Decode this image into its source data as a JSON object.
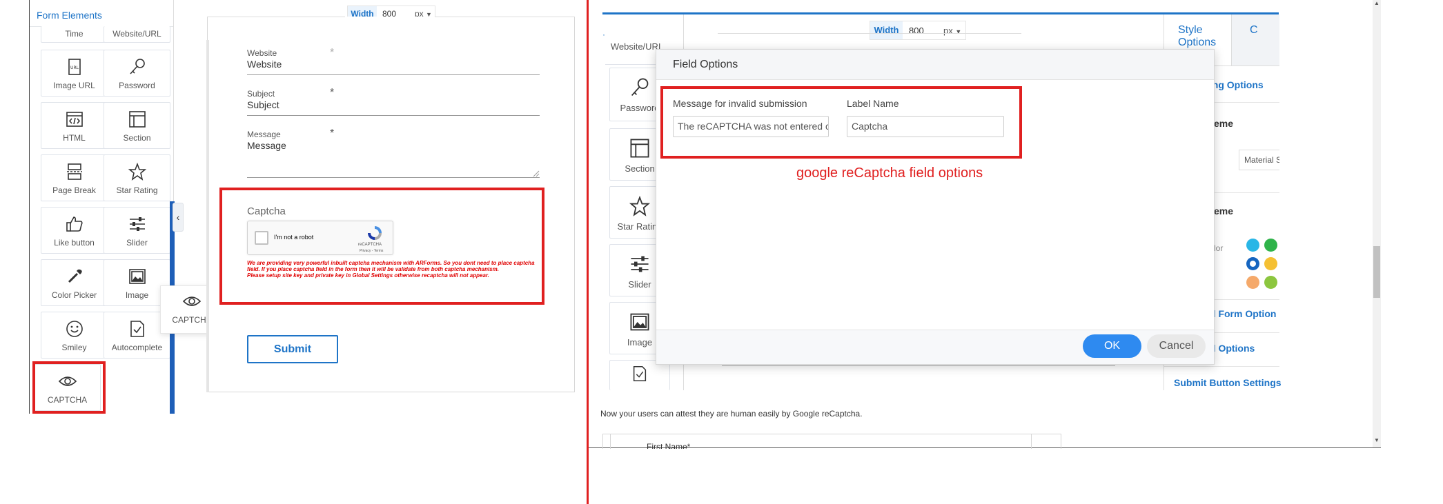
{
  "left_panel": {
    "header": "Form Elements",
    "elements": [
      {
        "label": "Time",
        "icon": "clock-icon"
      },
      {
        "label": "Website/URL",
        "icon": "globe-icon"
      },
      {
        "label": "Image URL",
        "icon": "image-url-icon"
      },
      {
        "label": "Password",
        "icon": "key-icon"
      },
      {
        "label": "HTML",
        "icon": "code-icon"
      },
      {
        "label": "Section",
        "icon": "section-icon"
      },
      {
        "label": "Page Break",
        "icon": "page-break-icon"
      },
      {
        "label": "Star Rating",
        "icon": "star-icon"
      },
      {
        "label": "Like button",
        "icon": "thumbs-up-icon"
      },
      {
        "label": "Slider",
        "icon": "slider-icon"
      },
      {
        "label": "Color Picker",
        "icon": "eyedropper-icon"
      },
      {
        "label": "Image",
        "icon": "image-icon"
      },
      {
        "label": "Smiley",
        "icon": "smiley-icon"
      },
      {
        "label": "Autocomplete",
        "icon": "autocomplete-icon"
      },
      {
        "label": "CAPTCHA",
        "icon": "eye-icon"
      }
    ],
    "drag_ghost_label": "CAPTCHA"
  },
  "width_bar": {
    "label": "Width",
    "value": "800",
    "unit": "px"
  },
  "form": {
    "fields": [
      {
        "label": "Website",
        "value": "Website"
      },
      {
        "label": "Subject",
        "value": "Subject"
      },
      {
        "label": "Message",
        "value": "Message"
      }
    ],
    "captcha": {
      "label": "Captcha",
      "checkbox_text": "I'm not a robot",
      "brand": "reCAPTCHA",
      "terms": "Privacy - Terms",
      "warning_1": "We are providing very powerful inbuilt captcha mechanism with ARForms. So you dont need to place captcha field. If you place captcha field in the form then it will be validate from both captcha mechanism.",
      "warning_2": "Please setup site key and private key in Global Settings otherwise recaptcha will not appear."
    },
    "submit_label": "Submit"
  },
  "right_screen": {
    "width_bar": {
      "label": "Width",
      "value": "800",
      "unit": "px"
    },
    "sidebar_items": [
      {
        "label": "Website/URL",
        "icon": "globe-icon"
      },
      {
        "label": "Password",
        "icon": "key-icon"
      },
      {
        "label": "Section",
        "icon": "section-icon"
      },
      {
        "label": "Star Rating",
        "icon": "star-icon"
      },
      {
        "label": "Slider",
        "icon": "slider-icon"
      },
      {
        "label": "Image",
        "icon": "image-icon"
      },
      {
        "label": "",
        "icon": "autocomplete-icon"
      }
    ],
    "style_panel": {
      "tab_active": "Style Options",
      "tab_next": "C",
      "rows": [
        "ling Options",
        "eme",
        "eme",
        "d Form Option",
        "d Options",
        "Submit Button Settings"
      ],
      "select_value": "Material S",
      "color_label": "lor",
      "swatches": [
        "#29b6e6",
        "#2fb34a",
        "#1565c0",
        "#f5c033",
        "#f5a96a",
        "#8cc63f"
      ]
    },
    "dialog": {
      "title": "Field Options",
      "invalid_label": "Message for invalid submission",
      "invalid_value": "The reCAPTCHA was not entered c",
      "label_name_label": "Label Name",
      "label_name_value": "Captcha",
      "annotation": "google reCaptcha field options",
      "ok_label": "OK",
      "cancel_label": "Cancel"
    },
    "caption": "Now your users can attest they are human easily by Google reCaptcha.",
    "partial_field_label": "First Name*"
  }
}
